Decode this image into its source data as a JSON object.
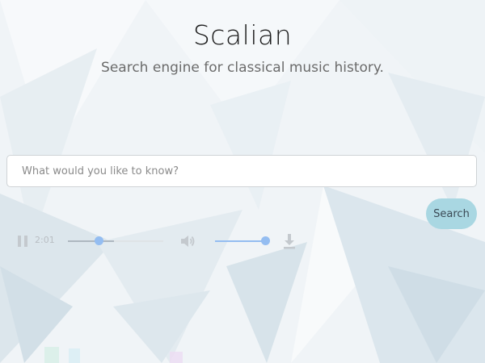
{
  "header": {
    "title": "Scalian",
    "subtitle": "Search engine for classical music history."
  },
  "search": {
    "placeholder": "What would you like to know?",
    "value": "",
    "button_label": "Search"
  },
  "player": {
    "state_icon": "pause-icon",
    "time": "2:01",
    "progress_fraction": 0.32,
    "buffered_fraction": 0.48,
    "volume_icon": "volume-icon",
    "volume_fraction": 1.0,
    "download_icon": "download-icon"
  },
  "colors": {
    "search_button_bg": "#a9d7e2",
    "slider_accent": "#94bdf1",
    "background": "#f1f5f8"
  }
}
